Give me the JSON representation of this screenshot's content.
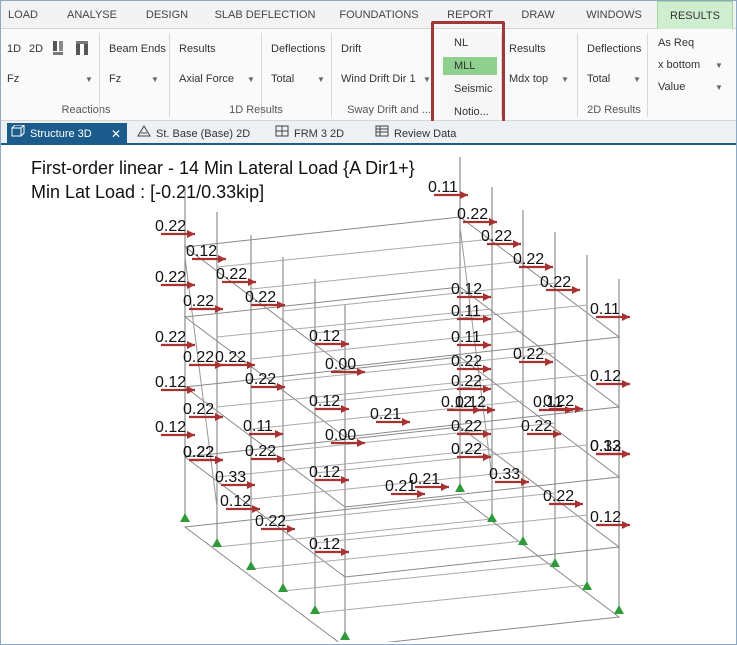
{
  "ribbon": {
    "tabs": [
      {
        "label": "LOAD"
      },
      {
        "label": "ANALYSE"
      },
      {
        "label": "DESIGN"
      },
      {
        "label": "SLAB DEFLECTION"
      },
      {
        "label": "FOUNDATIONS"
      },
      {
        "label": "REPORT"
      },
      {
        "label": "DRAW"
      },
      {
        "label": "WINDOWS"
      },
      {
        "label": "RESULTS"
      }
    ],
    "reactions": {
      "btn_1d": "1D",
      "btn_2d": "2D",
      "dropdown": "Fz",
      "group_label": "Reactions"
    },
    "results_1d": {
      "beam_ends": "Beam Ends",
      "beam_ends_dropdown": "Fz",
      "results": "Results",
      "results_dropdown": "Axial Force",
      "deflections": "Deflections",
      "deflections_dropdown": "Total",
      "group_label": "1D Results"
    },
    "sway": {
      "drift": "Drift",
      "drift_dropdown": "Wind Drift Dir 1",
      "group_label": "Sway Drift and ..."
    },
    "analysis_popup": {
      "items": [
        "NL",
        "MLL",
        "Seismic",
        "Notio..."
      ],
      "selected": "MLL"
    },
    "results_2d": {
      "results": "Results",
      "results_dropdown": "Mdx top",
      "deflections": "Deflections",
      "deflections_dropdown": "Total",
      "as_req": "As Req",
      "x_bottom": "x bottom",
      "value": "Value",
      "group_label": "2D Results"
    }
  },
  "doc_tabs": [
    {
      "label": "Structure 3D",
      "active": true
    },
    {
      "label": "St. Base (Base) 2D",
      "active": false
    },
    {
      "label": "FRM 3 2D",
      "active": false
    },
    {
      "label": "Review Data",
      "active": false
    }
  ],
  "view": {
    "title_line1": "First-order linear - 14 Min Lateral Load {A Dir1+}",
    "title_line2": "Min Lat Load : [-0.21/0.33kip]",
    "force_labels": [
      "0.11",
      "0.22",
      "0.22",
      "0.22",
      "0.12",
      "0.22",
      "0.22",
      "0.22",
      "0.12",
      "0.22",
      "0.11",
      "0.22",
      "0.22",
      "0.11",
      "0.12",
      "0.22",
      "0.22",
      "0.22",
      "0.11",
      "0.22",
      "0.00",
      "0.12",
      "0.22",
      "0.22",
      "0.22",
      "0.12",
      "0.12",
      "0.22",
      "0.12",
      "0.22",
      "0.11",
      "0.12",
      "0.21",
      "0.12",
      "0.11",
      "0.00",
      "0.22",
      "0.22",
      "0.22",
      "0.12",
      "0.22",
      "0.22",
      "0.12",
      "0.21",
      "0.33",
      "0.12",
      "0.33",
      "0.22",
      "0.22",
      "0.12",
      "0.12",
      "0.21",
      "0.22",
      "0.33"
    ]
  },
  "colors": {
    "accent": "#1c5c8c",
    "arrow": "#a83232",
    "support": "#2e9a3a",
    "highlight": "#a03838",
    "tab_active": "#cfeecf"
  }
}
